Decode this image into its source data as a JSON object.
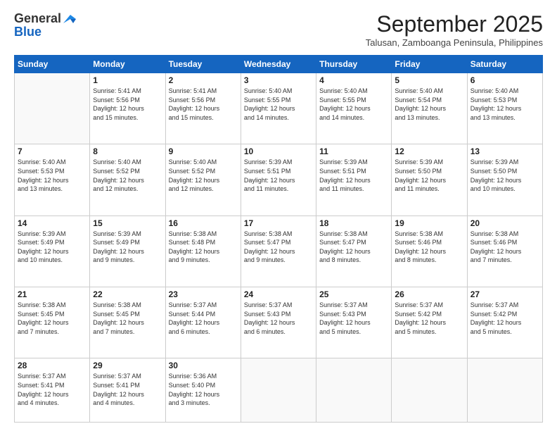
{
  "header": {
    "logo_general": "General",
    "logo_blue": "Blue",
    "month_title": "September 2025",
    "subtitle": "Talusan, Zamboanga Peninsula, Philippines"
  },
  "days_of_week": [
    "Sunday",
    "Monday",
    "Tuesday",
    "Wednesday",
    "Thursday",
    "Friday",
    "Saturday"
  ],
  "weeks": [
    [
      {
        "day": "",
        "info": ""
      },
      {
        "day": "1",
        "info": "Sunrise: 5:41 AM\nSunset: 5:56 PM\nDaylight: 12 hours\nand 15 minutes."
      },
      {
        "day": "2",
        "info": "Sunrise: 5:41 AM\nSunset: 5:56 PM\nDaylight: 12 hours\nand 15 minutes."
      },
      {
        "day": "3",
        "info": "Sunrise: 5:40 AM\nSunset: 5:55 PM\nDaylight: 12 hours\nand 14 minutes."
      },
      {
        "day": "4",
        "info": "Sunrise: 5:40 AM\nSunset: 5:55 PM\nDaylight: 12 hours\nand 14 minutes."
      },
      {
        "day": "5",
        "info": "Sunrise: 5:40 AM\nSunset: 5:54 PM\nDaylight: 12 hours\nand 13 minutes."
      },
      {
        "day": "6",
        "info": "Sunrise: 5:40 AM\nSunset: 5:53 PM\nDaylight: 12 hours\nand 13 minutes."
      }
    ],
    [
      {
        "day": "7",
        "info": "Sunrise: 5:40 AM\nSunset: 5:53 PM\nDaylight: 12 hours\nand 13 minutes."
      },
      {
        "day": "8",
        "info": "Sunrise: 5:40 AM\nSunset: 5:52 PM\nDaylight: 12 hours\nand 12 minutes."
      },
      {
        "day": "9",
        "info": "Sunrise: 5:40 AM\nSunset: 5:52 PM\nDaylight: 12 hours\nand 12 minutes."
      },
      {
        "day": "10",
        "info": "Sunrise: 5:39 AM\nSunset: 5:51 PM\nDaylight: 12 hours\nand 11 minutes."
      },
      {
        "day": "11",
        "info": "Sunrise: 5:39 AM\nSunset: 5:51 PM\nDaylight: 12 hours\nand 11 minutes."
      },
      {
        "day": "12",
        "info": "Sunrise: 5:39 AM\nSunset: 5:50 PM\nDaylight: 12 hours\nand 11 minutes."
      },
      {
        "day": "13",
        "info": "Sunrise: 5:39 AM\nSunset: 5:50 PM\nDaylight: 12 hours\nand 10 minutes."
      }
    ],
    [
      {
        "day": "14",
        "info": "Sunrise: 5:39 AM\nSunset: 5:49 PM\nDaylight: 12 hours\nand 10 minutes."
      },
      {
        "day": "15",
        "info": "Sunrise: 5:39 AM\nSunset: 5:49 PM\nDaylight: 12 hours\nand 9 minutes."
      },
      {
        "day": "16",
        "info": "Sunrise: 5:38 AM\nSunset: 5:48 PM\nDaylight: 12 hours\nand 9 minutes."
      },
      {
        "day": "17",
        "info": "Sunrise: 5:38 AM\nSunset: 5:47 PM\nDaylight: 12 hours\nand 9 minutes."
      },
      {
        "day": "18",
        "info": "Sunrise: 5:38 AM\nSunset: 5:47 PM\nDaylight: 12 hours\nand 8 minutes."
      },
      {
        "day": "19",
        "info": "Sunrise: 5:38 AM\nSunset: 5:46 PM\nDaylight: 12 hours\nand 8 minutes."
      },
      {
        "day": "20",
        "info": "Sunrise: 5:38 AM\nSunset: 5:46 PM\nDaylight: 12 hours\nand 7 minutes."
      }
    ],
    [
      {
        "day": "21",
        "info": "Sunrise: 5:38 AM\nSunset: 5:45 PM\nDaylight: 12 hours\nand 7 minutes."
      },
      {
        "day": "22",
        "info": "Sunrise: 5:38 AM\nSunset: 5:45 PM\nDaylight: 12 hours\nand 7 minutes."
      },
      {
        "day": "23",
        "info": "Sunrise: 5:37 AM\nSunset: 5:44 PM\nDaylight: 12 hours\nand 6 minutes."
      },
      {
        "day": "24",
        "info": "Sunrise: 5:37 AM\nSunset: 5:43 PM\nDaylight: 12 hours\nand 6 minutes."
      },
      {
        "day": "25",
        "info": "Sunrise: 5:37 AM\nSunset: 5:43 PM\nDaylight: 12 hours\nand 5 minutes."
      },
      {
        "day": "26",
        "info": "Sunrise: 5:37 AM\nSunset: 5:42 PM\nDaylight: 12 hours\nand 5 minutes."
      },
      {
        "day": "27",
        "info": "Sunrise: 5:37 AM\nSunset: 5:42 PM\nDaylight: 12 hours\nand 5 minutes."
      }
    ],
    [
      {
        "day": "28",
        "info": "Sunrise: 5:37 AM\nSunset: 5:41 PM\nDaylight: 12 hours\nand 4 minutes."
      },
      {
        "day": "29",
        "info": "Sunrise: 5:37 AM\nSunset: 5:41 PM\nDaylight: 12 hours\nand 4 minutes."
      },
      {
        "day": "30",
        "info": "Sunrise: 5:36 AM\nSunset: 5:40 PM\nDaylight: 12 hours\nand 3 minutes."
      },
      {
        "day": "",
        "info": ""
      },
      {
        "day": "",
        "info": ""
      },
      {
        "day": "",
        "info": ""
      },
      {
        "day": "",
        "info": ""
      }
    ]
  ]
}
